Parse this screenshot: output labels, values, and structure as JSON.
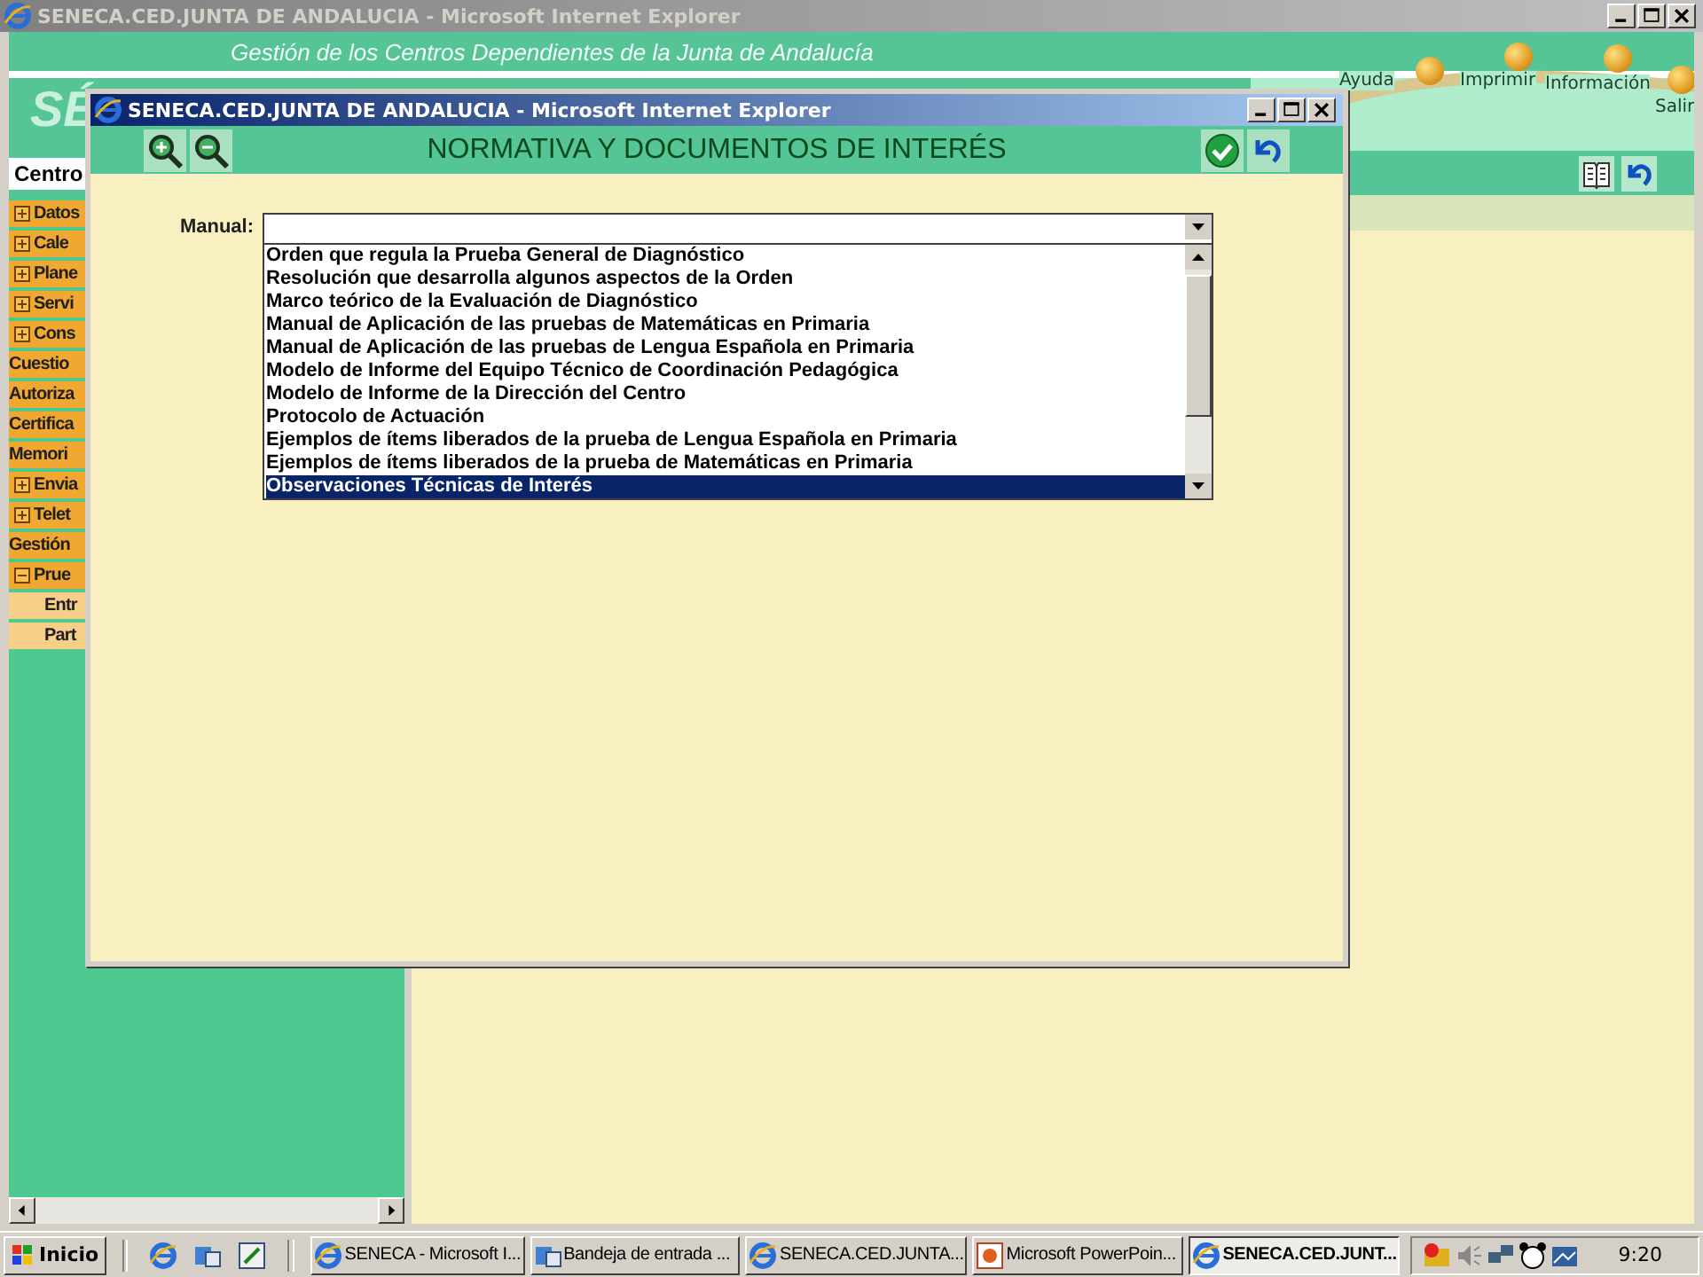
{
  "main_window": {
    "title": "SENECA.CED.JUNTA DE ANDALUCIA - Microsoft Internet Explorer",
    "logo": "SÉ",
    "subtitle": "Gestión de los Centros Dependientes de  la Junta de Andalucía",
    "nav": [
      {
        "label": "Ayuda"
      },
      {
        "label": "Imprimir"
      },
      {
        "label": "Información"
      },
      {
        "label": "Salir"
      }
    ],
    "tab": "Centro",
    "sidebar": [
      {
        "kind": "group",
        "label": "Datos",
        "expanded": false
      },
      {
        "kind": "group",
        "label": "Cale",
        "expanded": false
      },
      {
        "kind": "group",
        "label": "Plane",
        "expanded": false
      },
      {
        "kind": "group",
        "label": "Servi",
        "expanded": false
      },
      {
        "kind": "group",
        "label": "Cons",
        "expanded": false
      },
      {
        "kind": "link",
        "label": "Cuestio"
      },
      {
        "kind": "link",
        "label": "Autoriza"
      },
      {
        "kind": "link",
        "label": "Certifica"
      },
      {
        "kind": "link",
        "label": "Memori"
      },
      {
        "kind": "group",
        "label": "Envia",
        "expanded": false
      },
      {
        "kind": "group",
        "label": "Telet",
        "expanded": false
      },
      {
        "kind": "link",
        "label": "Gestión"
      },
      {
        "kind": "group",
        "label": "Prue",
        "expanded": true
      },
      {
        "kind": "subitem",
        "label": "Entr"
      },
      {
        "kind": "subitem",
        "label": "Part"
      }
    ]
  },
  "dialog": {
    "title": "SENECA.CED.JUNTA DE ANDALUCIA - Microsoft Internet Explorer",
    "heading": "NORMATIVA Y DOCUMENTOS DE INTERÉS",
    "field_label": "Manual:",
    "options": [
      {
        "label": "Orden que regula la Prueba General de Diagnóstico",
        "selected": false
      },
      {
        "label": "Resolución que desarrolla algunos aspectos de la Orden",
        "selected": false
      },
      {
        "label": "Marco teórico de la Evaluación de Diagnóstico",
        "selected": false
      },
      {
        "label": "Manual de Aplicación de las pruebas de Matemáticas en Primaria",
        "selected": false
      },
      {
        "label": "Manual de Aplicación de las pruebas de Lengua Española en Primaria",
        "selected": false
      },
      {
        "label": "Modelo de Informe del Equipo Técnico de Coordinación Pedagógica",
        "selected": false
      },
      {
        "label": "Modelo de Informe de la Dirección del Centro",
        "selected": false
      },
      {
        "label": "Protocolo de Actuación",
        "selected": false
      },
      {
        "label": "Ejemplos de ítems liberados de la prueba de Lengua Española en Primaria",
        "selected": false
      },
      {
        "label": "Ejemplos de ítems liberados de la prueba de Matemáticas en Primaria",
        "selected": false
      },
      {
        "label": "Observaciones Técnicas de Interés",
        "selected": true
      }
    ]
  },
  "taskbar": {
    "start": "Inicio",
    "tasks": [
      {
        "kind": "browser",
        "label": "SENECA - Microsoft I...",
        "active": false
      },
      {
        "kind": "mail",
        "label": "Bandeja de entrada ...",
        "active": false
      },
      {
        "kind": "browser",
        "label": "SENECA.CED.JUNTA...",
        "active": false
      },
      {
        "kind": "slides",
        "label": "Microsoft PowerPoin...",
        "active": false
      },
      {
        "kind": "browser",
        "label": "SENECA.CED.JUNT...",
        "active": true
      }
    ],
    "clock": "9:20"
  }
}
